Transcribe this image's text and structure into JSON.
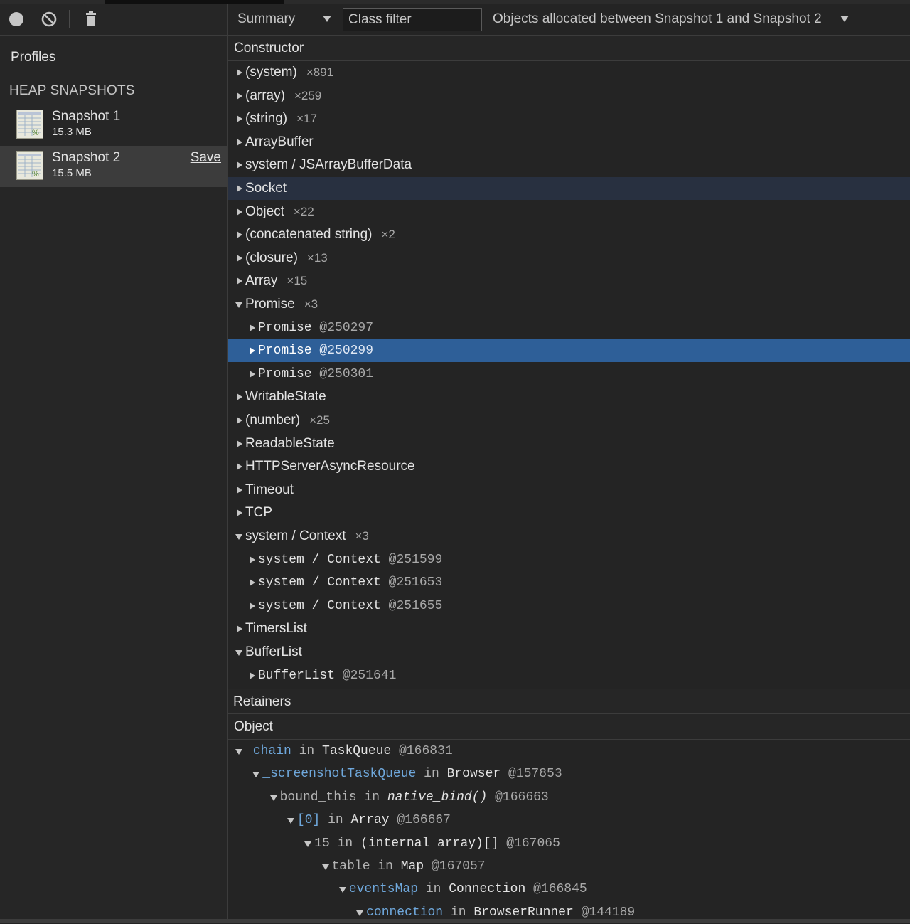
{
  "sidebar": {
    "profiles_label": "Profiles",
    "section_label": "HEAP SNAPSHOTS",
    "snapshots": [
      {
        "name": "Snapshot 1",
        "size": "15.3 MB"
      },
      {
        "name": "Snapshot 2",
        "size": "15.5 MB",
        "action": "Save",
        "selected": true
      }
    ]
  },
  "toolbar": {
    "view": "Summary",
    "class_filter_placeholder": "Class filter",
    "range": "Objects allocated between Snapshot 1 and Snapshot 2"
  },
  "constructor_header": "Constructor",
  "constructors": [
    {
      "name": "(system)",
      "count": "×891",
      "expanded": false
    },
    {
      "name": "(array)",
      "count": "×259",
      "expanded": false
    },
    {
      "name": "(string)",
      "count": "×17",
      "expanded": false
    },
    {
      "name": "ArrayBuffer",
      "count": "",
      "expanded": false
    },
    {
      "name": "system / JSArrayBufferData",
      "count": "",
      "expanded": false
    },
    {
      "name": "Socket",
      "count": "",
      "expanded": false,
      "hover": true
    },
    {
      "name": "Object",
      "count": "×22",
      "expanded": false
    },
    {
      "name": "(concatenated string)",
      "count": "×2",
      "expanded": false
    },
    {
      "name": "(closure)",
      "count": "×13",
      "expanded": false
    },
    {
      "name": "Array",
      "count": "×15",
      "expanded": false
    },
    {
      "name": "Promise",
      "count": "×3",
      "expanded": true,
      "children": [
        {
          "name": "Promise",
          "id": "@250297"
        },
        {
          "name": "Promise",
          "id": "@250299",
          "selected": true
        },
        {
          "name": "Promise",
          "id": "@250301"
        }
      ]
    },
    {
      "name": "WritableState",
      "count": "",
      "expanded": false
    },
    {
      "name": "(number)",
      "count": "×25",
      "expanded": false
    },
    {
      "name": "ReadableState",
      "count": "",
      "expanded": false
    },
    {
      "name": "HTTPServerAsyncResource",
      "count": "",
      "expanded": false
    },
    {
      "name": "Timeout",
      "count": "",
      "expanded": false
    },
    {
      "name": "TCP",
      "count": "",
      "expanded": false
    },
    {
      "name": "system / Context",
      "count": "×3",
      "expanded": true,
      "children": [
        {
          "name": "system / Context",
          "id": "@251599"
        },
        {
          "name": "system / Context",
          "id": "@251653"
        },
        {
          "name": "system / Context",
          "id": "@251655"
        }
      ]
    },
    {
      "name": "TimersList",
      "count": "",
      "expanded": false
    },
    {
      "name": "BufferList",
      "count": "",
      "expanded": true,
      "children": [
        {
          "name": "BufferList",
          "id": "@251641"
        }
      ]
    }
  ],
  "retainers_header": "Retainers",
  "object_header": "Object",
  "retainers": [
    {
      "prop": "_chain",
      "prop_style": "link",
      "in": "in",
      "owner": "TaskQueue",
      "owner_italic": false,
      "id": "@166831"
    },
    {
      "prop": "_screenshotTaskQueue",
      "prop_style": "link",
      "in": "in",
      "owner": "Browser",
      "owner_italic": false,
      "id": "@157853"
    },
    {
      "prop": "bound_this",
      "prop_style": "plain",
      "in": "in",
      "owner": "native_bind()",
      "owner_italic": true,
      "id": "@166663"
    },
    {
      "prop": "[0]",
      "prop_style": "link",
      "in": "in",
      "owner": "Array",
      "owner_italic": false,
      "id": "@166667"
    },
    {
      "prop": "15",
      "prop_style": "plain",
      "in": "in",
      "owner": "(internal array)[]",
      "owner_italic": false,
      "id": "@167065"
    },
    {
      "prop": "table",
      "prop_style": "plain",
      "in": "in",
      "owner": "Map",
      "owner_italic": false,
      "id": "@167057"
    },
    {
      "prop": "eventsMap",
      "prop_style": "link",
      "in": "in",
      "owner": "Connection",
      "owner_italic": false,
      "id": "@166845"
    },
    {
      "prop": "connection",
      "prop_style": "link",
      "in": "in",
      "owner": "BrowserRunner",
      "owner_italic": false,
      "id": "@144189"
    }
  ]
}
